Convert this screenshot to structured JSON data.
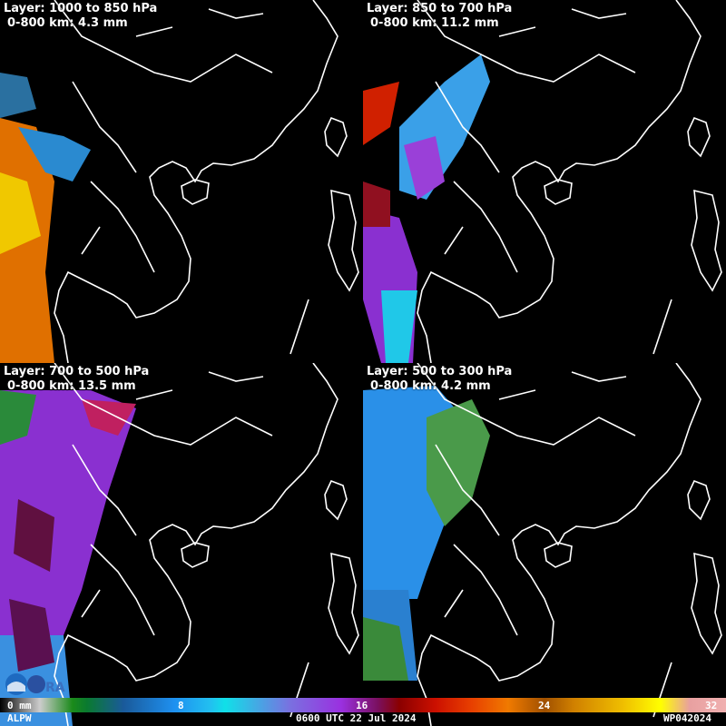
{
  "panels": [
    {
      "layer": "Layer: 1000 to 850 hPa",
      "value": "0-800 km: 4.3 mm"
    },
    {
      "layer": "Layer: 850 to 700 hPa",
      "value": "0-800 km: 11.2 mm"
    },
    {
      "layer": "Layer: 700 to 500 hPa",
      "value": "0-800 km: 13.5 mm"
    },
    {
      "layer": "Layer: 500 to 300 hPa",
      "value": "0-800 km: 4.2 mm"
    }
  ],
  "colorbar": {
    "unit_label": "0 mm",
    "ticks": [
      "8",
      "16",
      "24",
      "32"
    ],
    "tick_values": [
      8,
      16,
      24,
      32
    ],
    "min": 0,
    "max": 32
  },
  "footer": {
    "product": "ALPW",
    "time": "0600 UTC 22 Jul 2024",
    "storm_id": "WP042024"
  },
  "logo": {
    "text": "NOAA CIRA"
  }
}
